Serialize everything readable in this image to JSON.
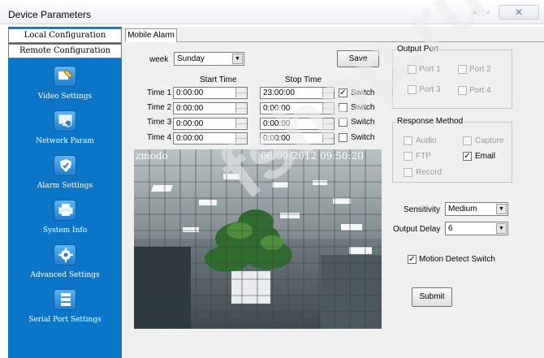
{
  "window": {
    "title": "Device Parameters",
    "close_label": "✕"
  },
  "sidebar": {
    "local_config": "Local Configuration",
    "remote_config": "Remote Configuration",
    "items": [
      {
        "label": "Video Settings",
        "icon": "video-settings-icon"
      },
      {
        "label": "Network Param",
        "icon": "network-icon"
      },
      {
        "label": "Alarm Settings",
        "icon": "shield-icon"
      },
      {
        "label": "System Info",
        "icon": "printer-icon"
      },
      {
        "label": "Advanced Settings",
        "icon": "gear-icon"
      },
      {
        "label": "Serial Port Settings",
        "icon": "server-icon"
      }
    ]
  },
  "tab": {
    "label": "Mobile Alarm"
  },
  "schedule": {
    "week_label": "week",
    "week_value": "Sunday",
    "save_label": "Save",
    "start_header": "Start Time",
    "stop_header": "Stop Time",
    "rows": [
      {
        "label": "Time 1",
        "start": "0:00:00",
        "stop": "23:00:00",
        "switch_label": "Switch",
        "switch_checked": true
      },
      {
        "label": "Time 2",
        "start": "0:00:00",
        "stop": "0:00:00",
        "switch_label": "Switch",
        "switch_checked": false
      },
      {
        "label": "Time 3",
        "start": "0:00:00",
        "stop": "0:00:00",
        "switch_label": "Switch",
        "switch_checked": false
      },
      {
        "label": "Time 4",
        "start": "0:00:00",
        "stop": "0:00:00",
        "switch_label": "Switch",
        "switch_checked": false
      }
    ]
  },
  "video": {
    "osd_name": "zmodo",
    "osd_datetime": "06/09/2012 09:50:20"
  },
  "output_port": {
    "title": "Output Port",
    "ports": [
      {
        "label": "Port 1",
        "checked": false
      },
      {
        "label": "Port 2",
        "checked": false
      },
      {
        "label": "Port 3",
        "checked": false
      },
      {
        "label": "Port 4",
        "checked": false
      }
    ]
  },
  "response_method": {
    "title": "Response Method",
    "options": [
      {
        "label": "Audio",
        "checked": false,
        "enabled": false
      },
      {
        "label": "Capture",
        "checked": false,
        "enabled": false
      },
      {
        "label": "FTP",
        "checked": false,
        "enabled": false
      },
      {
        "label": "Email",
        "checked": true,
        "enabled": true
      },
      {
        "label": "Record",
        "checked": false,
        "enabled": false
      }
    ]
  },
  "settings": {
    "sensitivity_label": "Sensitivity",
    "sensitivity_value": "Medium",
    "output_delay_label": "Output Delay",
    "output_delay_value": "6",
    "motion_switch_label": "Motion Detect Switch",
    "motion_switch_checked": true,
    "submit_label": "Submit"
  },
  "watermark": "fshop.ru",
  "colors": {
    "sidebar": "#0b76c8",
    "panel": "#f0f0f0"
  }
}
